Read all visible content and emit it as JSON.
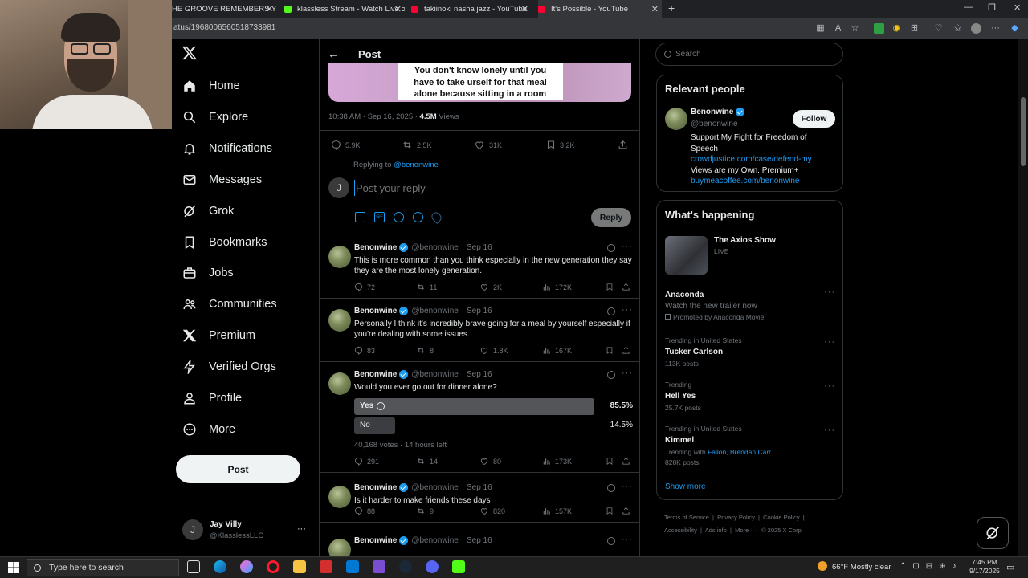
{
  "browser": {
    "tabs": [
      {
        "title": "HE GROOVE REMEMBERS YOU",
        "color": "#d93025"
      },
      {
        "title": "klassless Stream - Watch Live on",
        "color": "#53fc18"
      },
      {
        "title": "takiinoki nasha jazz - YouTube",
        "color": "#ff0033"
      },
      {
        "title": "It's Possible - YouTube",
        "color": "#ff0033"
      }
    ],
    "new_tab": "+",
    "url": "atus/1968006560518733981"
  },
  "nav": {
    "items": [
      {
        "label": "Home",
        "icon": "home-icon"
      },
      {
        "label": "Explore",
        "icon": "search-icon"
      },
      {
        "label": "Notifications",
        "icon": "bell-icon"
      },
      {
        "label": "Messages",
        "icon": "envelope-icon"
      },
      {
        "label": "Grok",
        "icon": "grok-icon"
      },
      {
        "label": "Bookmarks",
        "icon": "bookmark-icon"
      },
      {
        "label": "Jobs",
        "icon": "briefcase-icon"
      },
      {
        "label": "Communities",
        "icon": "people-icon"
      },
      {
        "label": "Premium",
        "icon": "x-icon"
      },
      {
        "label": "Verified Orgs",
        "icon": "lightning-icon"
      },
      {
        "label": "Profile",
        "icon": "person-icon"
      },
      {
        "label": "More",
        "icon": "more-circle-icon"
      }
    ],
    "post_button": "Post",
    "user": {
      "name": "Jay Villy",
      "handle": "@KlasslessLLC",
      "initial": "J",
      "more": "···"
    }
  },
  "header": {
    "title": "Post"
  },
  "main_post": {
    "image_caption_lines": [
      "You don't know lonely until you",
      "have to take urself for that meal",
      "alone because sitting in a room"
    ],
    "time": "10:38 AM · Sep 16, 2025 · ",
    "views_count": "4.5M",
    "views_label": " Views",
    "stats": {
      "replies": "5.9K",
      "reposts": "2.5K",
      "likes": "31K",
      "bookmarks": "3.2K"
    }
  },
  "composer": {
    "replying_to_label": "Replying to ",
    "replying_to_handle": "@benonwine",
    "avatar_initial": "J",
    "placeholder": "Post your reply",
    "reply_button": "Reply"
  },
  "replies": [
    {
      "name": "Benonwine",
      "handle": "@benonwine",
      "date": "· Sep 16",
      "text": "This is more common than you think especially in the new generation they say they are the most lonely generation.",
      "replies": "72",
      "reposts": "11",
      "likes": "2K",
      "views": "172K"
    },
    {
      "name": "Benonwine",
      "handle": "@benonwine",
      "date": "· Sep 16",
      "text": "Personally I think it's incredibly brave going for a meal by yourself especially if you're dealing with some issues.",
      "replies": "83",
      "reposts": "8",
      "likes": "1.8K",
      "views": "167K"
    },
    {
      "name": "Benonwine",
      "handle": "@benonwine",
      "date": "· Sep 16",
      "text": "Would you ever go out for dinner alone?",
      "replies": "291",
      "reposts": "14",
      "likes": "80",
      "views": "173K",
      "poll": {
        "options": [
          {
            "label": "Yes",
            "percent": "85.5%",
            "fraction": 0.855,
            "selected": true
          },
          {
            "label": "No",
            "percent": "14.5%",
            "fraction": 0.145,
            "selected": false
          }
        ],
        "meta": "40,168 votes · 14 hours left"
      }
    },
    {
      "name": "Benonwine",
      "handle": "@benonwine",
      "date": "· Sep 16",
      "text": "Is it harder to make friends these days",
      "replies": "88",
      "reposts": "9",
      "likes": "820",
      "views": "157K"
    },
    {
      "name": "Benonwine",
      "handle": "@benonwine",
      "date": "· Sep 16",
      "text": "",
      "replies": "",
      "reposts": "",
      "likes": "",
      "views": ""
    }
  ],
  "right": {
    "search_placeholder": "Search",
    "relevant": {
      "title": "Relevant people",
      "name": "Benonwine",
      "handle": "@benonwine",
      "follow": "Follow",
      "bio1": "Support My Fight for Freedom of Speech",
      "link1": "crowdjustice.com/case/defend-my...",
      "bio2": "Views are my Own. Premium+",
      "link2": "buymeacoffee.com/benonwine"
    },
    "happening": {
      "title": "What's happening",
      "live_title": "The Axios Show",
      "live_label": "LIVE",
      "trends": [
        {
          "top": "",
          "name": "Anaconda",
          "sub": "Watch the new trailer now",
          "extra": "Promoted by Anaconda Movie"
        },
        {
          "top": "Trending in United States",
          "name": "Tucker Carlson",
          "sub": "113K posts",
          "extra": ""
        },
        {
          "top": "Trending",
          "name": "Hell Yes",
          "sub": "25.7K posts",
          "extra": ""
        },
        {
          "top": "Trending in United States",
          "name": "Kimmel",
          "sub": "828K posts",
          "extra": "",
          "with_label": "Trending with ",
          "with_links": "Fallon, Brendan Carr"
        }
      ],
      "show_more": "Show more"
    },
    "footer": {
      "terms": "Terms of Service",
      "privacy": "Privacy Policy",
      "cookie": "Cookie Policy",
      "access": "Accessibility",
      "ads": "Ads info",
      "more": "More ···",
      "copy": "© 2025 X Corp."
    }
  },
  "taskbar": {
    "search_placeholder": "Type here to search",
    "weather": "66°F  Mostly clear",
    "time": "7:45 PM",
    "date": "9/17/2025"
  }
}
